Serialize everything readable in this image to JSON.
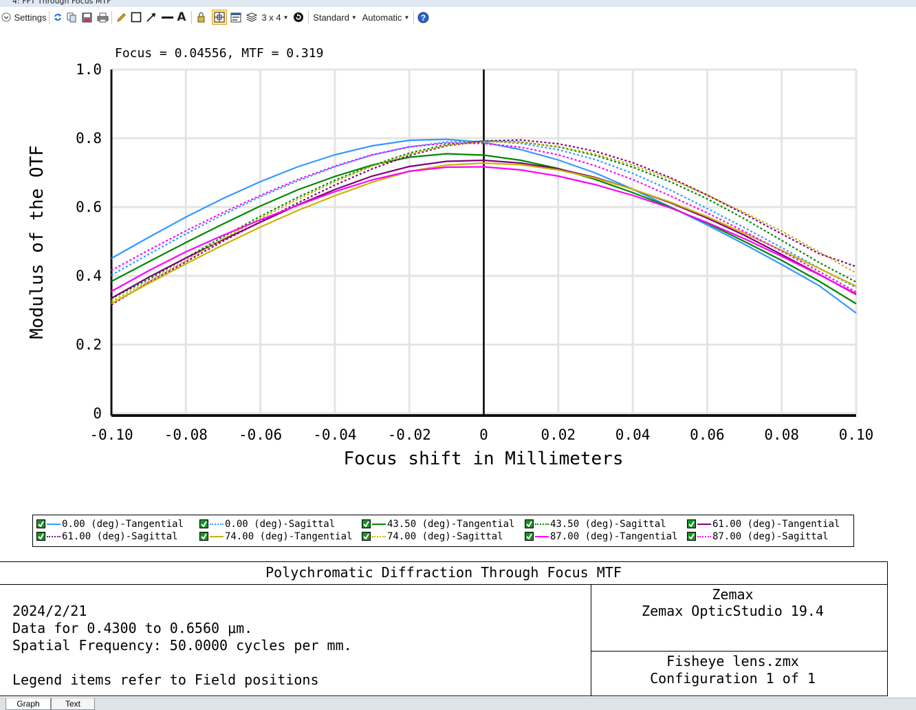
{
  "window": {
    "title": "4: FFT Through Focus MTF"
  },
  "toolbar": {
    "settings_label": "Settings",
    "layout_label": "3 x 4",
    "standard_label": "Standard",
    "automatic_label": "Automatic",
    "icons": [
      "settings-chevron-icon",
      "refresh-icon",
      "copy-icon",
      "save-icon",
      "print-icon",
      "pencil-icon",
      "rectangle-icon",
      "arrow-icon",
      "line-icon",
      "text-icon",
      "lock-icon",
      "grid-icon",
      "window-icon",
      "layers-icon",
      "rotate-icon",
      "help-icon"
    ]
  },
  "plot": {
    "header": "Focus = 0.04556, MTF = 0.319"
  },
  "chart_data": {
    "type": "line",
    "xlabel": "Focus shift in Millimeters",
    "ylabel": "Modulus of the OTF",
    "xlim": [
      -0.1,
      0.1
    ],
    "ylim": [
      0,
      1.0
    ],
    "x_ticks": [
      "-0.10",
      "-0.08",
      "-0.06",
      "-0.04",
      "-0.02",
      "0",
      "0.02",
      "0.04",
      "0.06",
      "0.08",
      "0.10"
    ],
    "y_ticks": [
      "0",
      "0.2",
      "0.4",
      "0.6",
      "0.8",
      "1.0"
    ],
    "grid": true,
    "cursor_x": 0,
    "x": [
      -0.1,
      -0.09,
      -0.08,
      -0.07,
      -0.06,
      -0.05,
      -0.04,
      -0.03,
      -0.02,
      -0.01,
      0,
      0.01,
      0.02,
      0.03,
      0.04,
      0.05,
      0.06,
      0.07,
      0.08,
      0.09,
      0.1
    ],
    "series": [
      {
        "name": "0.00 (deg)-Tangential",
        "color": "#3399ff",
        "dash": "solid",
        "values": [
          0.451,
          0.512,
          0.571,
          0.625,
          0.674,
          0.717,
          0.752,
          0.778,
          0.794,
          0.797,
          0.788,
          0.767,
          0.737,
          0.699,
          0.652,
          0.601,
          0.548,
          0.492,
          0.433,
          0.372,
          0.292
        ]
      },
      {
        "name": "0.00 (deg)-Sagittal",
        "color": "#3399ff",
        "dash": "dotted",
        "values": [
          0.402,
          0.463,
          0.522,
          0.578,
          0.63,
          0.676,
          0.717,
          0.751,
          0.775,
          0.789,
          0.792,
          0.785,
          0.767,
          0.738,
          0.698,
          0.65,
          0.596,
          0.54,
          0.482,
          0.423,
          0.366
        ]
      },
      {
        "name": "43.50 (deg)-Tangential",
        "color": "#008800",
        "dash": "solid",
        "values": [
          0.384,
          0.441,
          0.497,
          0.551,
          0.603,
          0.65,
          0.689,
          0.722,
          0.745,
          0.755,
          0.751,
          0.736,
          0.712,
          0.68,
          0.642,
          0.6,
          0.553,
          0.5,
          0.445,
          0.385,
          0.319
        ]
      },
      {
        "name": "43.50 (deg)-Sagittal",
        "color": "#008800",
        "dash": "dotted",
        "values": [
          0.334,
          0.39,
          0.452,
          0.514,
          0.573,
          0.628,
          0.678,
          0.721,
          0.757,
          0.782,
          0.792,
          0.789,
          0.775,
          0.75,
          0.716,
          0.674,
          0.624,
          0.566,
          0.503,
          0.439,
          0.382
        ]
      },
      {
        "name": "61.00 (deg)-Tangential",
        "color": "#800080",
        "dash": "solid",
        "values": [
          0.335,
          0.396,
          0.452,
          0.505,
          0.556,
          0.606,
          0.651,
          0.69,
          0.718,
          0.733,
          0.736,
          0.728,
          0.711,
          0.686,
          0.652,
          0.613,
          0.568,
          0.518,
          0.462,
          0.405,
          0.346
        ]
      },
      {
        "name": "61.00 (deg)-Sagittal",
        "color": "#800080",
        "dash": "dotted",
        "values": [
          0.316,
          0.381,
          0.441,
          0.501,
          0.557,
          0.612,
          0.664,
          0.711,
          0.75,
          0.778,
          0.792,
          0.795,
          0.784,
          0.762,
          0.729,
          0.686,
          0.635,
          0.58,
          0.522,
          0.465,
          0.427
        ]
      },
      {
        "name": "74.00 (deg)-Tangential",
        "color": "#c8b400",
        "dash": "solid",
        "values": [
          0.32,
          0.378,
          0.435,
          0.49,
          0.542,
          0.59,
          0.633,
          0.672,
          0.704,
          0.722,
          0.728,
          0.723,
          0.708,
          0.684,
          0.652,
          0.615,
          0.572,
          0.524,
          0.474,
          0.422,
          0.37
        ]
      },
      {
        "name": "74.00 (deg)-Sagittal",
        "color": "#c8b400",
        "dash": "dotted",
        "values": [
          0.326,
          0.384,
          0.445,
          0.508,
          0.567,
          0.622,
          0.674,
          0.719,
          0.754,
          0.779,
          0.79,
          0.789,
          0.776,
          0.754,
          0.722,
          0.682,
          0.635,
          0.584,
          0.53,
          0.47,
          0.408
        ]
      },
      {
        "name": "87.00 (deg)-Tangential",
        "color": "#ff00ff",
        "dash": "solid",
        "values": [
          0.355,
          0.415,
          0.47,
          0.518,
          0.563,
          0.605,
          0.645,
          0.679,
          0.704,
          0.716,
          0.717,
          0.708,
          0.69,
          0.665,
          0.634,
          0.598,
          0.555,
          0.508,
          0.457,
          0.404,
          0.348
        ]
      },
      {
        "name": "87.00 (deg)-Sagittal",
        "color": "#ff00ff",
        "dash": "dotted",
        "values": [
          0.416,
          0.475,
          0.531,
          0.584,
          0.634,
          0.68,
          0.719,
          0.752,
          0.775,
          0.786,
          0.785,
          0.774,
          0.752,
          0.72,
          0.68,
          0.633,
          0.583,
          0.529,
          0.472,
          0.413,
          0.353
        ]
      }
    ]
  },
  "info": {
    "title": "Polychromatic Diffraction Through Focus MTF",
    "date": "2024/2/21",
    "data_line": "Data for 0.4300 to 0.6560 μm.",
    "freq_line": "Spatial Frequency: 50.0000 cycles per mm.",
    "legend_note": "Legend items refer to Field positions",
    "company": "Zemax",
    "product": "Zemax OpticStudio 19.4",
    "file": "Fisheye lens.zmx",
    "config": "Configuration 1 of 1"
  },
  "tabs": [
    "Graph",
    "Text"
  ]
}
